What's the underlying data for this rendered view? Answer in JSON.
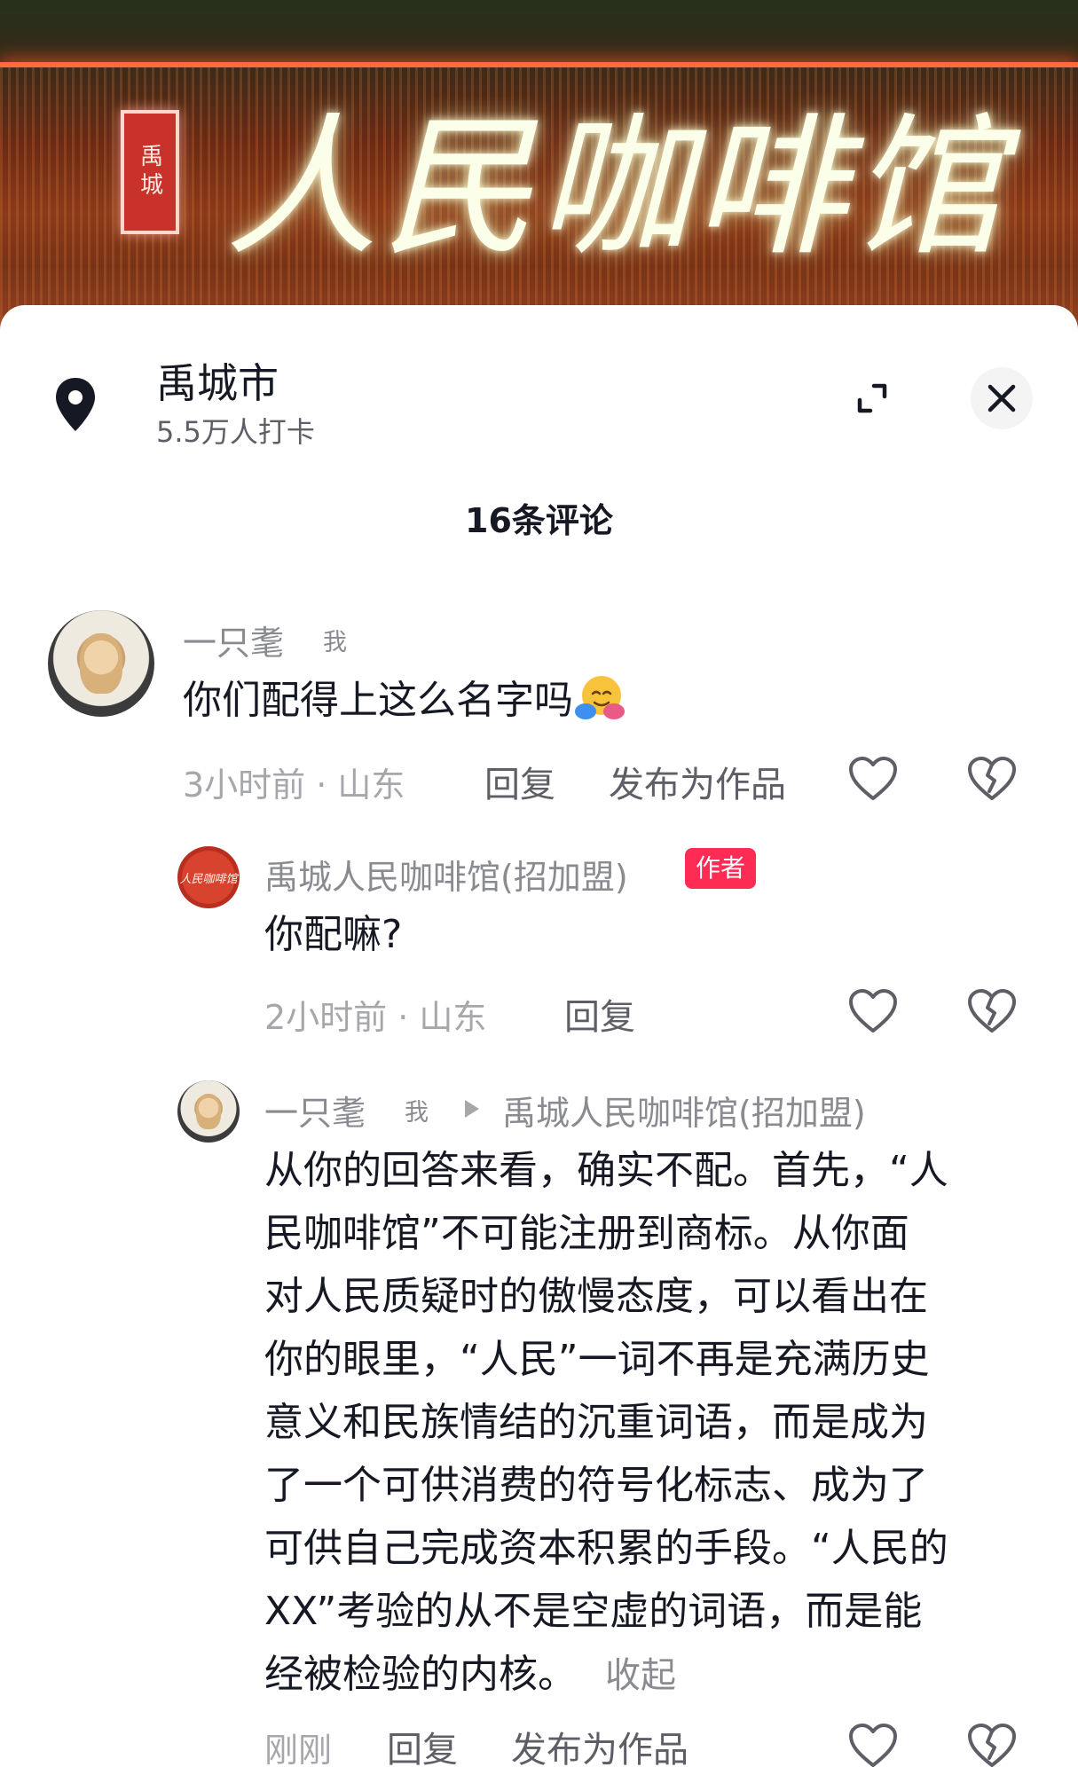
{
  "hero": {
    "sign_text": "人民咖啡馆",
    "seal_text": "禹城"
  },
  "location": {
    "title": "禹城市",
    "checkins": "5.5万人打卡"
  },
  "comments_count": "16条评论",
  "comments": [
    {
      "user": "一只耄",
      "me_tag": "我",
      "text": "你们配得上这么名字吗",
      "emoji": "hugging-face-emoji",
      "time_place": "3小时前 · 山东",
      "reply_label": "回复",
      "publish_label": "发布为作品"
    },
    {
      "user": "禹城人民咖啡馆(招加盟)",
      "author_tag": "作者",
      "avatar_text": "人民咖啡馆",
      "text": "你配嘛?",
      "time_place": "2小时前 · 山东",
      "reply_label": "回复"
    },
    {
      "user": "一只耄",
      "me_tag": "我",
      "reply_to": "禹城人民咖啡馆(招加盟)",
      "lines": [
        "从你的回答来看，确实不配。首先，“人",
        "民咖啡馆”不可能注册到商标。从你面",
        "对人民质疑时的傲慢态度，可以看出在",
        "你的眼里，“人民”一词不再是充满历史",
        "意义和民族情结的沉重词语，而是成为",
        "了一个可供消费的符号化标志、成为了",
        "可供自己完成资本积累的手段。“人民的",
        "XX”考验的从不是空虚的词语，而是能",
        "经被检验的内核。"
      ],
      "collapse_label": "收起",
      "time_place": "刚刚",
      "reply_label": "回复",
      "publish_label": "发布为作品"
    }
  ],
  "colors": {
    "author_badge": "#fe2c55",
    "muted": "#a6a7ab",
    "text": "#161823"
  }
}
